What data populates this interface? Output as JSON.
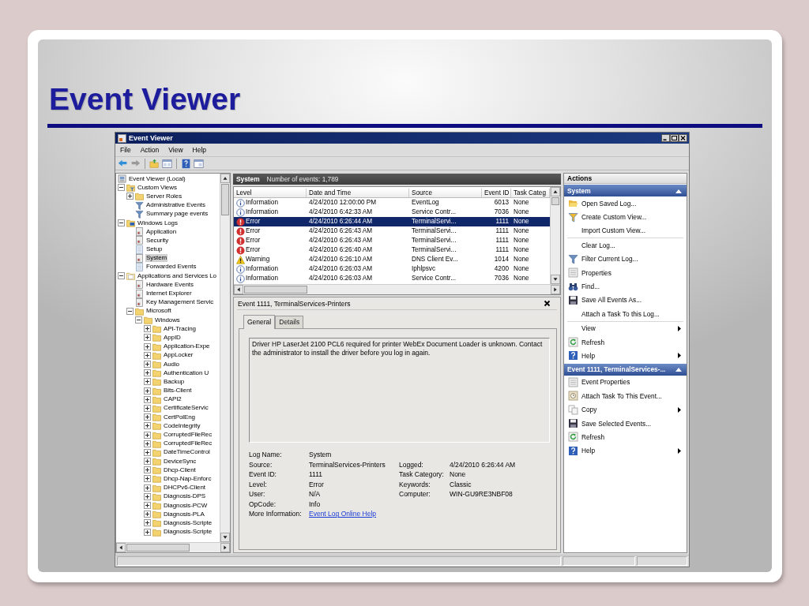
{
  "slide": {
    "title": "Event Viewer"
  },
  "window": {
    "title": "Event Viewer"
  },
  "menu": [
    "File",
    "Action",
    "View",
    "Help"
  ],
  "toolbar": [
    {
      "kind": "back"
    },
    {
      "kind": "forward"
    },
    {
      "kind": "separator"
    },
    {
      "kind": "up"
    },
    {
      "kind": "console"
    },
    {
      "kind": "separator"
    },
    {
      "kind": "help"
    },
    {
      "kind": "panel"
    }
  ],
  "tree": [
    {
      "label": "Event Viewer (Local)",
      "kind": "root",
      "selected": false,
      "children": [
        {
          "label": "Custom Views",
          "kind": "views",
          "expanded": true,
          "selected": false,
          "children": [
            {
              "label": "Server Roles",
              "kind": "folder",
              "expanded": false,
              "selected": false
            },
            {
              "label": "Administrative Events",
              "kind": "filter",
              "selected": false
            },
            {
              "label": "Summary page events",
              "kind": "filter",
              "selected": false
            }
          ]
        },
        {
          "label": "Windows Logs",
          "kind": "winlogs",
          "expanded": true,
          "selected": false,
          "children": [
            {
              "label": "Application",
              "kind": "log",
              "selected": false
            },
            {
              "label": "Security",
              "kind": "log",
              "selected": false
            },
            {
              "label": "Setup",
              "kind": "blank",
              "selected": false
            },
            {
              "label": "System",
              "kind": "log",
              "selected": true
            },
            {
              "label": "Forwarded Events",
              "kind": "blank",
              "selected": false
            }
          ]
        },
        {
          "label": "Applications and Services Lo",
          "kind": "apps",
          "expanded": true,
          "selected": false,
          "children": [
            {
              "label": "Hardware Events",
              "kind": "log",
              "selected": false
            },
            {
              "label": "Internet Explorer",
              "kind": "log",
              "selected": false
            },
            {
              "label": "Key Management Servic",
              "kind": "log",
              "selected": false
            },
            {
              "label": "Microsoft",
              "kind": "folder",
              "expanded": true,
              "selected": false,
              "children": [
                {
                  "label": "Windows",
                  "kind": "folder",
                  "expanded": true,
                  "selected": false,
                  "children": [
                    {
                      "label": "API-Tracing",
                      "kind": "folder",
                      "expanded": false,
                      "selected": false
                    },
                    {
                      "label": "AppID",
                      "kind": "folder",
                      "expanded": false,
                      "selected": false
                    },
                    {
                      "label": "Application-Expe",
                      "kind": "folder",
                      "expanded": false,
                      "selected": false
                    },
                    {
                      "label": "AppLocker",
                      "kind": "folder",
                      "expanded": false,
                      "selected": false
                    },
                    {
                      "label": "Audio",
                      "kind": "folder",
                      "expanded": false,
                      "selected": false
                    },
                    {
                      "label": "Authentication U",
                      "kind": "folder",
                      "expanded": false,
                      "selected": false
                    },
                    {
                      "label": "Backup",
                      "kind": "folder",
                      "expanded": false,
                      "selected": false
                    },
                    {
                      "label": "Bits-Client",
                      "kind": "folder",
                      "expanded": false,
                      "selected": false
                    },
                    {
                      "label": "CAPI2",
                      "kind": "folder",
                      "expanded": false,
                      "selected": false
                    },
                    {
                      "label": "CertificateServic",
                      "kind": "folder",
                      "expanded": false,
                      "selected": false
                    },
                    {
                      "label": "CertPolEng",
                      "kind": "folder",
                      "expanded": false,
                      "selected": false
                    },
                    {
                      "label": "CodeIntegrity",
                      "kind": "folder",
                      "expanded": false,
                      "selected": false
                    },
                    {
                      "label": "CorruptedFileRec",
                      "kind": "folder",
                      "expanded": false,
                      "selected": false
                    },
                    {
                      "label": "CorruptedFileRec",
                      "kind": "folder",
                      "expanded": false,
                      "selected": false
                    },
                    {
                      "label": "DateTimeControl",
                      "kind": "folder",
                      "expanded": false,
                      "selected": false
                    },
                    {
                      "label": "DeviceSync",
                      "kind": "folder",
                      "expanded": false,
                      "selected": false
                    },
                    {
                      "label": "Dhcp-Client",
                      "kind": "folder",
                      "expanded": false,
                      "selected": false
                    },
                    {
                      "label": "Dhcp-Nap-Enforc",
                      "kind": "folder",
                      "expanded": false,
                      "selected": false
                    },
                    {
                      "label": "DHCPv6-Client",
                      "kind": "folder",
                      "expanded": false,
                      "selected": false
                    },
                    {
                      "label": "Diagnosis-DPS",
                      "kind": "folder",
                      "expanded": false,
                      "selected": false
                    },
                    {
                      "label": "Diagnosis-PCW",
                      "kind": "folder",
                      "expanded": false,
                      "selected": false
                    },
                    {
                      "label": "Diagnosis-PLA",
                      "kind": "folder",
                      "expanded": false,
                      "selected": false
                    },
                    {
                      "label": "Diagnosis-Scripte",
                      "kind": "folder",
                      "expanded": false,
                      "selected": false
                    },
                    {
                      "label": "Diagnosis-Scripte",
                      "kind": "folder",
                      "expanded": false,
                      "selected": false
                    }
                  ]
                }
              ]
            }
          ]
        }
      ]
    }
  ],
  "log_view": {
    "name": "System",
    "count": "Number of events: 1,789",
    "columns": [
      "Level",
      "Date and Time",
      "Source",
      "Event ID",
      "Task Categ"
    ],
    "rows": [
      {
        "kind": "information",
        "level": "Information",
        "date_time": "4/24/2010 12:00:00 PM",
        "source": "EventLog",
        "event_id": "6013",
        "task_category": "None",
        "selected": false
      },
      {
        "kind": "information",
        "level": "Information",
        "date_time": "4/24/2010 6:42:33 AM",
        "source": "Service Contr...",
        "event_id": "7036",
        "task_category": "None",
        "selected": false
      },
      {
        "kind": "error",
        "level": "Error",
        "date_time": "4/24/2010 6:26:44 AM",
        "source": "TerminalServi...",
        "event_id": "1111",
        "task_category": "None",
        "selected": true
      },
      {
        "kind": "error",
        "level": "Error",
        "date_time": "4/24/2010 6:26:43 AM",
        "source": "TerminalServi...",
        "event_id": "1111",
        "task_category": "None",
        "selected": false
      },
      {
        "kind": "error",
        "level": "Error",
        "date_time": "4/24/2010 6:26:43 AM",
        "source": "TerminalServi...",
        "event_id": "1111",
        "task_category": "None",
        "selected": false
      },
      {
        "kind": "error",
        "level": "Error",
        "date_time": "4/24/2010 6:26:40 AM",
        "source": "TerminalServi...",
        "event_id": "1111",
        "task_category": "None",
        "selected": false
      },
      {
        "kind": "warning",
        "level": "Warning",
        "date_time": "4/24/2010 6:26:10 AM",
        "source": "DNS Client Ev...",
        "event_id": "1014",
        "task_category": "None",
        "selected": false
      },
      {
        "kind": "information",
        "level": "Information",
        "date_time": "4/24/2010 6:26:03 AM",
        "source": "Iphlpsvc",
        "event_id": "4200",
        "task_category": "None",
        "selected": false
      },
      {
        "kind": "information",
        "level": "Information",
        "date_time": "4/24/2010 6:26:03 AM",
        "source": "Service Contr...",
        "event_id": "7036",
        "task_category": "None",
        "selected": false
      }
    ]
  },
  "event": {
    "title": "Event 1111, TerminalServices-Printers",
    "tabs": [
      {
        "label": "General",
        "selected": true
      },
      {
        "label": "Details",
        "selected": false
      }
    ],
    "message": "Driver HP LaserJet 2100 PCL6 required for printer WebEx Document Loader is unknown. Contact the administrator to install the driver before you log in again.",
    "fields_left": [
      {
        "label": "Log Name:",
        "value": "System"
      },
      {
        "label": "Source:",
        "value": "TerminalServices-Printers"
      },
      {
        "label": "Event ID:",
        "value": "1111"
      },
      {
        "label": "Level:",
        "value": "Error"
      },
      {
        "label": "User:",
        "value": "N/A"
      },
      {
        "label": "OpCode:",
        "value": "Info"
      },
      {
        "label": "More Information:",
        "value": "Event Log Online Help",
        "kind": "link"
      }
    ],
    "fields_right": [
      {
        "label": "Logged:",
        "value": "4/24/2010 6:26:44 AM"
      },
      {
        "label": "Task Category:",
        "value": "None"
      },
      {
        "label": "Keywords:",
        "value": "Classic"
      },
      {
        "label": "Computer:",
        "value": "WIN-GU9RE3NBF08"
      }
    ]
  },
  "actions": {
    "title": "Actions",
    "sections": [
      {
        "title": "System",
        "expanded": true,
        "items": [
          {
            "kind": "open",
            "label": "Open Saved Log...",
            "submenu": false
          },
          {
            "kind": "create-view",
            "label": "Create Custom View...",
            "submenu": false
          },
          {
            "kind": "none",
            "label": "Import Custom View...",
            "submenu": false
          },
          {
            "kind": "separator"
          },
          {
            "kind": "none",
            "label": "Clear Log...",
            "submenu": false
          },
          {
            "kind": "filter",
            "label": "Filter Current Log...",
            "submenu": false
          },
          {
            "kind": "properties",
            "label": "Properties",
            "submenu": false
          },
          {
            "kind": "find",
            "label": "Find...",
            "submenu": false
          },
          {
            "kind": "save",
            "label": "Save All Events As...",
            "submenu": false
          },
          {
            "kind": "none",
            "label": "Attach a Task To this Log...",
            "submenu": false
          },
          {
            "kind": "separator"
          },
          {
            "kind": "none",
            "label": "View",
            "submenu": true
          },
          {
            "kind": "refresh",
            "label": "Refresh",
            "submenu": false
          },
          {
            "kind": "help",
            "label": "Help",
            "submenu": true
          }
        ]
      },
      {
        "title": "Event 1111, TerminalServices-...",
        "expanded": true,
        "items": [
          {
            "kind": "properties",
            "label": "Event Properties",
            "submenu": false
          },
          {
            "kind": "task",
            "label": "Attach Task To This Event...",
            "submenu": false
          },
          {
            "kind": "copy",
            "label": "Copy",
            "submenu": true
          },
          {
            "kind": "save",
            "label": "Save Selected Events...",
            "submenu": false
          },
          {
            "kind": "refresh",
            "label": "Refresh",
            "submenu": false
          },
          {
            "kind": "help",
            "label": "Help",
            "submenu": true
          }
        ]
      }
    ]
  }
}
